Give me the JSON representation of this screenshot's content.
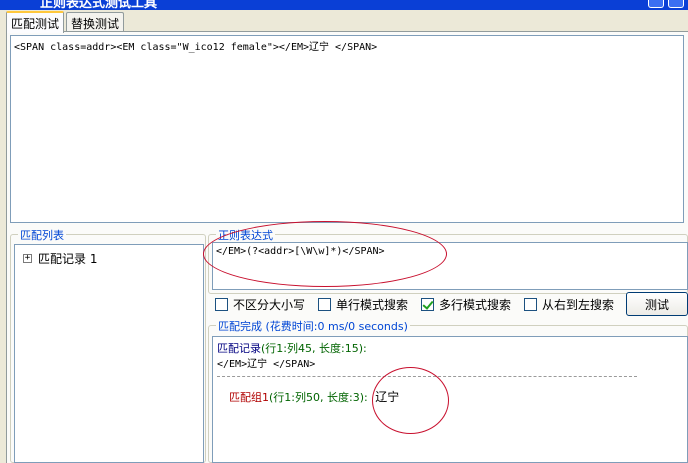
{
  "window": {
    "title": "正则表达式测试工具"
  },
  "tabs": [
    {
      "label": "匹配测试",
      "active": true
    },
    {
      "label": "替换测试",
      "active": false
    }
  ],
  "input": {
    "text": "<SPAN class=addr><EM class=\"W_ico12 female\"></EM>辽宁 </SPAN>"
  },
  "match_list": {
    "label": "匹配列表",
    "items": [
      {
        "expander": "+",
        "label": "匹配记录 1"
      }
    ]
  },
  "regex": {
    "label": "正则表达式",
    "value": "</EM>(?<addr>[\\W\\w]*)</SPAN>"
  },
  "options": [
    {
      "label": "不区分大小写",
      "checked": false
    },
    {
      "label": "单行模式搜索",
      "checked": false
    },
    {
      "label": "多行模式搜索",
      "checked": true
    },
    {
      "label": "从右到左搜索",
      "checked": false
    }
  ],
  "test_button": {
    "label": "测试"
  },
  "result": {
    "status_label": "匹配完成 (花费时间:0 ms/0 seconds)",
    "record_title": "匹配记录",
    "record_meta": "(行1:列45, 长度:15):",
    "record_text": "</EM>辽宁 </SPAN>",
    "group_title": "匹配组1",
    "group_meta": "(行1:列50, 长度:3):",
    "group_value": "辽宁"
  },
  "colors": {
    "annotation": "#c8102e",
    "checkbox_mark": "#21a121",
    "group_label": "#0046d5"
  }
}
